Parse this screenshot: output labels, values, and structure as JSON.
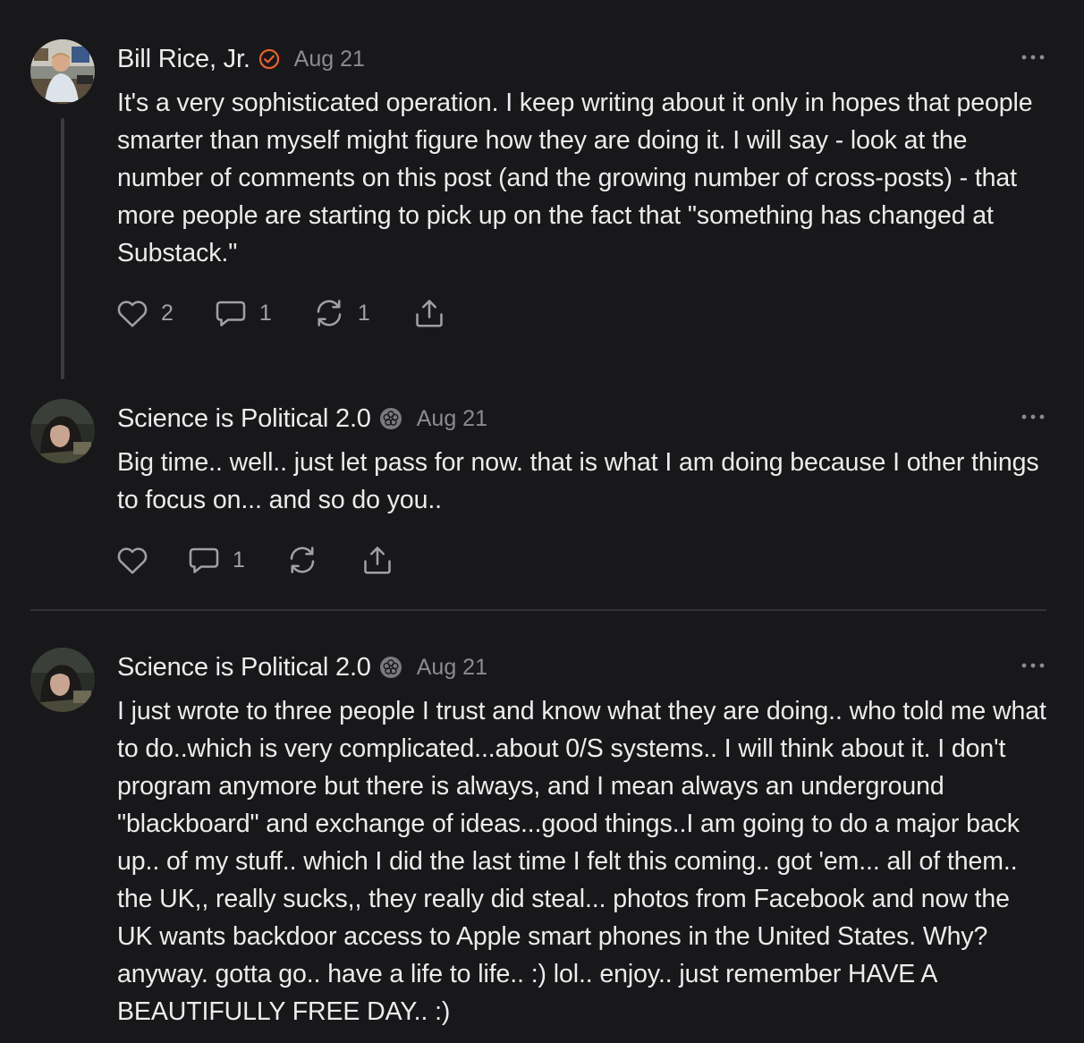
{
  "comments": [
    {
      "author": "Bill Rice, Jr.",
      "date": "Aug 21",
      "badge_icon": "verified-check-icon",
      "text": "It's a very sophisticated operation. I keep writing about it only in hopes that people smarter than myself might figure how they are doing it. I will say - look at the number of comments on this post (and the growing number of cross-posts) - that more people are starting to pick up on the fact that \"something has changed at Substack.\"",
      "likes": "2",
      "replies": "1",
      "restacks": "1"
    },
    {
      "author": "Science is Political 2.0",
      "date": "Aug 21",
      "badge_icon": "flower-badge-icon",
      "text": "Big time.. well.. just let pass for now. that is what I am doing because I other things to focus on... and so do you..",
      "likes": "",
      "replies": "1",
      "restacks": ""
    },
    {
      "author": "Science is Political 2.0",
      "date": "Aug 21",
      "badge_icon": "flower-badge-icon",
      "text": "I just wrote to three people I trust and know what they are doing.. who told me what to do..which is very complicated...about 0/S systems.. I will think about it. I don't program anymore but there is always, and I mean always an underground \"blackboard\" and exchange of ideas...good things..I am going to do a major back up.. of my stuff.. which I did the last time I felt this coming.. got 'em... all of them.. the UK,, really sucks,, they really did steal... photos from Facebook and now the UK wants backdoor access to Apple smart phones in the United States. Why? anyway. gotta go.. have a life to life.. :) lol.. enjoy.. just remember HAVE A BEAUTIFULLY FREE DAY.. :)"
    }
  ],
  "colors": {
    "background": "#18181a",
    "text": "#ececec",
    "muted": "#8c8c90",
    "verified_badge": "#e8622a"
  }
}
